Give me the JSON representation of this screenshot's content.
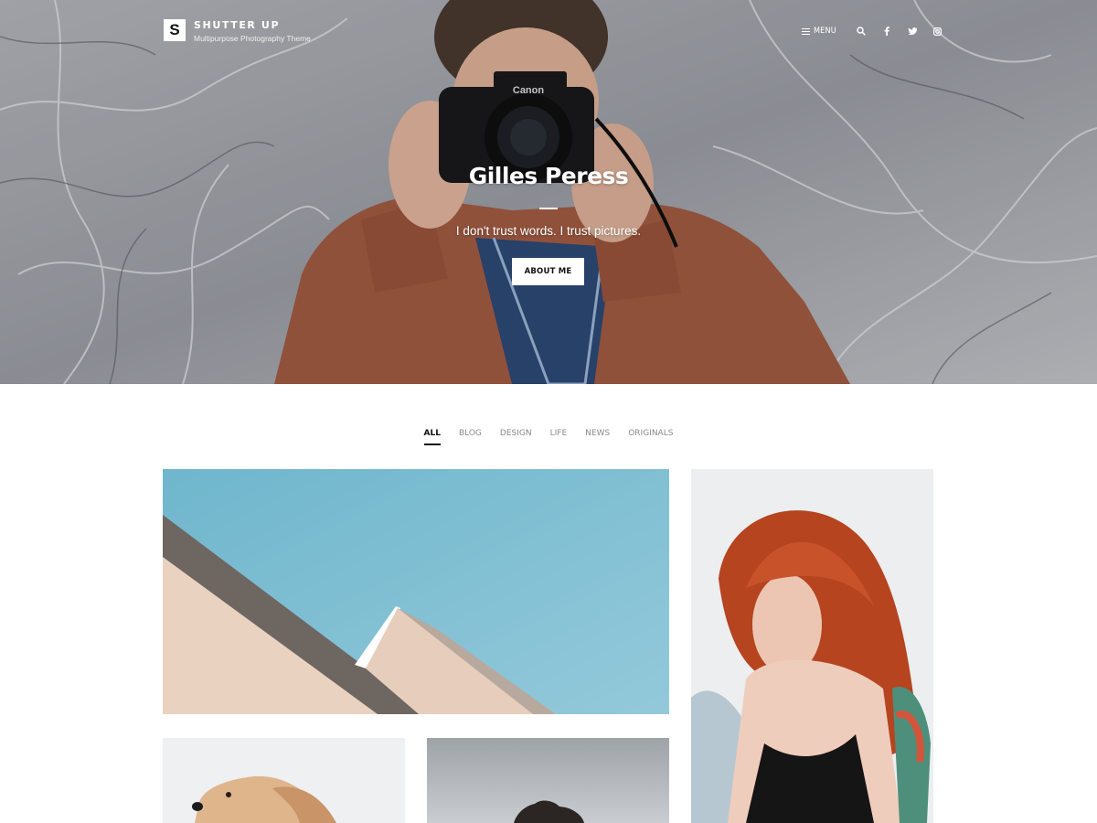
{
  "site": {
    "logo_letter": "S",
    "title": "SHUTTER UP",
    "tagline": "Multipurpose Photography Theme"
  },
  "nav": {
    "menu_label": "MENU",
    "icons": [
      "search-icon",
      "facebook-icon",
      "twitter-icon",
      "instagram-icon"
    ]
  },
  "hero": {
    "title": "Gilles Peress",
    "subtitle": "I don't trust words. I trust pictures.",
    "button_label": "ABOUT ME"
  },
  "filters": {
    "tabs": [
      "ALL",
      "BLOG",
      "DESIGN",
      "LIFE",
      "NEWS",
      "ORIGINALS"
    ],
    "active": "ALL"
  },
  "colors": {
    "accent": "#111111",
    "muted_tab": "#8a8a8a",
    "sky": "#7fbfd2",
    "jacket": "#a45d44"
  }
}
